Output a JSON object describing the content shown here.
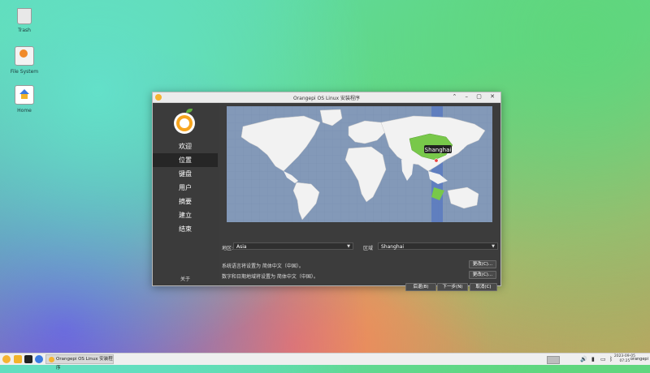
{
  "desktop": {
    "icons": [
      {
        "label": "Trash"
      },
      {
        "label": "File System"
      },
      {
        "label": "Home"
      }
    ]
  },
  "window": {
    "title": "Orangepi OS Linux 安装程序",
    "controls": "⌃ – ▢ ✕"
  },
  "sidebar": {
    "items": [
      {
        "label": "欢迎"
      },
      {
        "label": "位置"
      },
      {
        "label": "键盘"
      },
      {
        "label": "用户"
      },
      {
        "label": "摘要"
      },
      {
        "label": "建立"
      },
      {
        "label": "结束"
      }
    ],
    "active_index": 1,
    "about_label": "关于"
  },
  "map": {
    "selected_city": "Shanghai",
    "timezone_band_color": "#5a7ac0",
    "highlight_color": "#78c84a"
  },
  "location": {
    "region_label": "地区:",
    "region_value": "Asia",
    "zone_label": "区域",
    "zone_value": "Shanghai"
  },
  "info": {
    "language_text": "系统语言将设置为 简体中文（中国）。",
    "locale_text": "数字和日期地域将设置为 简体中文（中国）。",
    "change_label_1": "更改(C)...",
    "change_label_2": "更改(C)..."
  },
  "buttons": {
    "back": "后退(B)",
    "next": "下一步(N)",
    "cancel": "取消(C)"
  },
  "taskbar": {
    "task_label": "Orangepi OS Linux 安装程序",
    "date": "2023-09-05",
    "time": "07:25",
    "user": "orangepi",
    "volume_icon": "🔊",
    "battery_icon": "▮",
    "bluetooth_icon": "ᛒ"
  }
}
